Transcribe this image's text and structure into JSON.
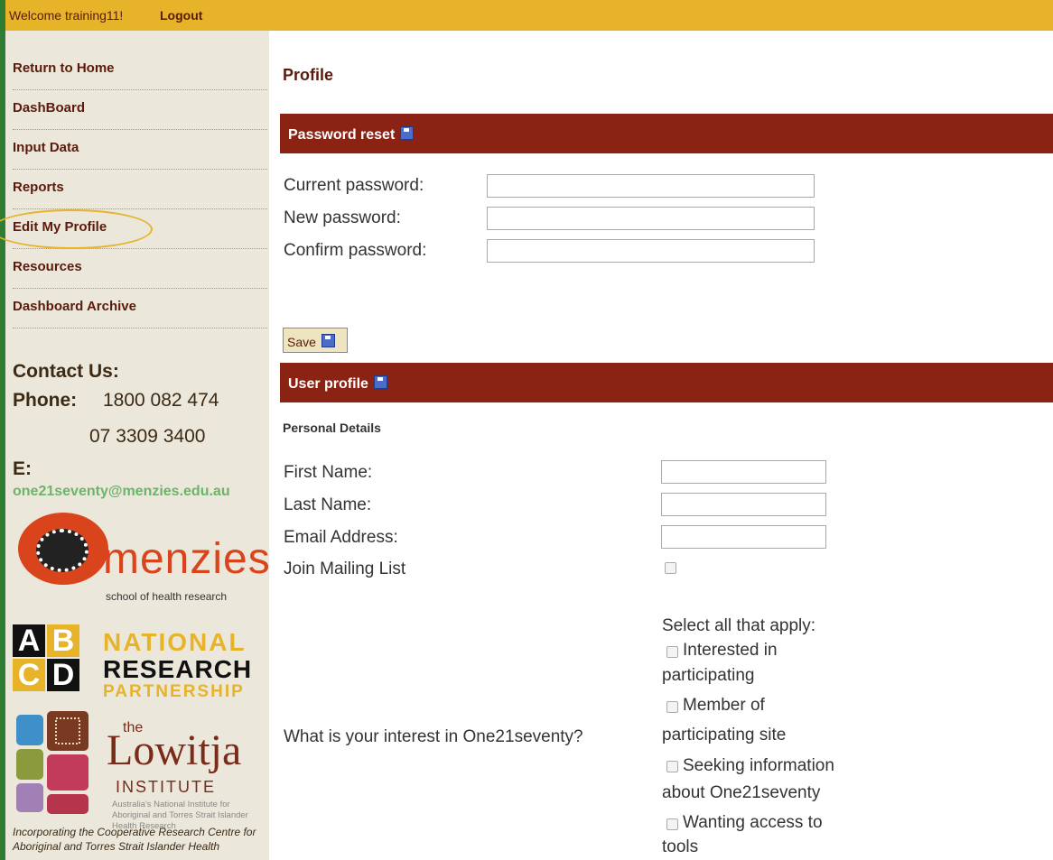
{
  "topbar": {
    "welcome": "Welcome training11!",
    "logout": "Logout"
  },
  "sidebar": {
    "items": [
      {
        "label": "Return to Home"
      },
      {
        "label": "DashBoard"
      },
      {
        "label": "Input Data"
      },
      {
        "label": "Reports"
      },
      {
        "label": "Edit My Profile"
      },
      {
        "label": "Resources"
      },
      {
        "label": "Dashboard Archive"
      }
    ],
    "contact_title": "Contact Us:",
    "phone_label": "Phone:",
    "phone1": "1800 082 474",
    "phone2": "07 3309 3400",
    "email_label": "E:",
    "email": "one21seventy@menzies.edu.au",
    "menzies_word": "menzies",
    "menzies_sub": "school of health research",
    "abcd": [
      "A",
      "B",
      "C",
      "D"
    ],
    "nrp_lines": [
      "NATIONAL",
      "RESEARCH",
      "PARTNERSHIP"
    ],
    "lowitja_the": "the",
    "lowitja_word": "Lowitja",
    "lowitja_institute": "INSTITUTE",
    "lowitja_desc": "Australia's National Institute for Aboriginal and Torres Strait Islander Health Research",
    "incorporating": "Incorporating the Cooperative Research Centre for Aboriginal and Torres Strait Islander Health"
  },
  "main": {
    "title": "Profile",
    "password_section": "Password reset",
    "current_password_label": "Current password:",
    "new_password_label": "New password:",
    "confirm_password_label": "Confirm password:",
    "save_label": "Save",
    "user_profile_section": "User profile",
    "personal_details": "Personal Details",
    "first_name_label": "First Name:",
    "last_name_label": "Last Name:",
    "email_label": "Email Address:",
    "mailing_label": "Join Mailing List",
    "select_all": "Select all that apply:",
    "interest_question": "What is your interest in One21seventy?",
    "options": [
      {
        "line1": "Interested in",
        "line2": "participating"
      },
      {
        "line1": "Member of",
        "line2": "participating site"
      },
      {
        "line1": "Seeking information",
        "line2": "about One21seventy"
      },
      {
        "line1": "Wanting access to",
        "line2": "tools"
      }
    ]
  },
  "colors": {
    "accent": "#e6b329",
    "section_bar": "#8b2314",
    "sidebar_bg": "#ece7db",
    "link_text": "#5a1a0c"
  }
}
